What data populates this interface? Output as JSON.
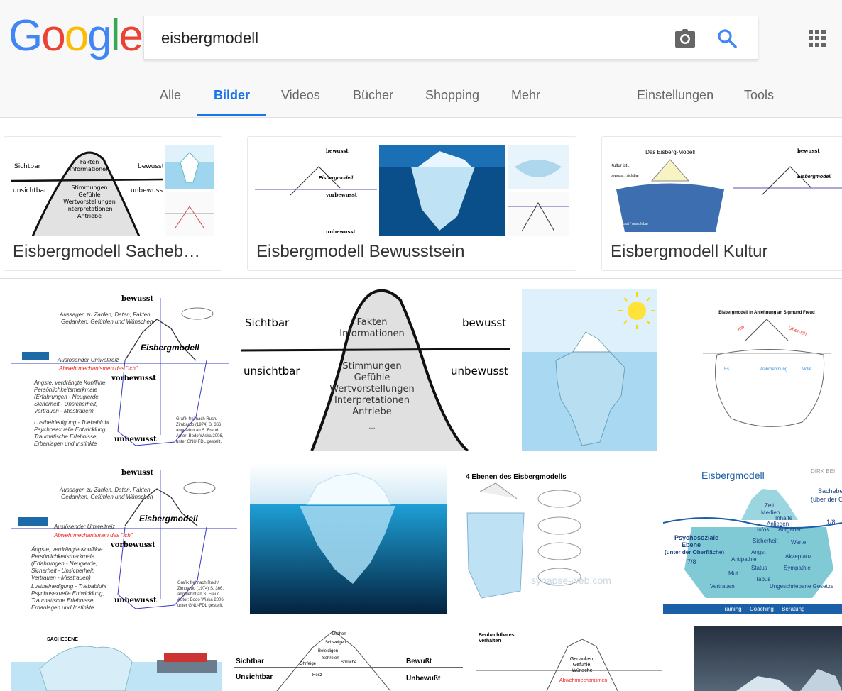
{
  "logo": {
    "letters": [
      "G",
      "o",
      "o",
      "g",
      "l",
      "e"
    ],
    "colors": [
      "#4285F4",
      "#EA4335",
      "#FBBC05",
      "#4285F4",
      "#34A853",
      "#EA4335"
    ]
  },
  "search": {
    "query": "eisbergmodell"
  },
  "tabs": {
    "alle": "Alle",
    "bilder": "Bilder",
    "videos": "Videos",
    "buecher": "Bücher",
    "shopping": "Shopping",
    "mehr": "Mehr",
    "einstellungen": "Einstellungen",
    "tools": "Tools"
  },
  "related": [
    {
      "title": "Eisbergmodell Sacheb…"
    },
    {
      "title": "Eisbergmodell Bewusstsein"
    },
    {
      "title": "Eisbergmodell Kultur"
    }
  ],
  "img_text": {
    "sichtbar": "Sichtbar",
    "unsichtbar": "unsichtbar",
    "bewusst_cut": "bewusst",
    "unbewusst_cut": "unbewusst",
    "fakten": "Fakten",
    "informationen": "Informationen",
    "stimmungen": "Stimmungen",
    "gefuehle": "Gefühle",
    "wertvorstellungen": "Wertvorstellungen",
    "interpretationen": "Interpretationen",
    "antriebe": "Antriebe",
    "dots": "...",
    "bewusst": "bewusst",
    "vorbewusst": "vorbewusst",
    "unbewusst": "unbewusst",
    "eisbergmodell_label": "Eisbergmodell",
    "aussagen": "Aussagen zu Zahlen, Daten, Fakten,",
    "gedanken": "Gedanken, Gefühlen und Wünschen",
    "ausloesender": "Auslösender Umweltreiz",
    "abwehr": "Abwehrmechanismen des \"Ich\"",
    "aengste1": "Ängste, verdrängte Konflikte",
    "aengste2": "Persönlichkeitsmerkmale",
    "aengste3": "(Erfahrungen - Neugierde,",
    "aengste4": "Sicherheit - Unsicherheit,",
    "aengste5": "Vertrauen - Misstrauen)",
    "lust1": "Lustbefriedigung - Triebabfuhr",
    "lust2": "Psychosexuelle Entwicklung,",
    "lust3": "Traumatische Erlebnisse,",
    "lust4": "Erbanlagen und Instinkte",
    "grafik1": "Grafik frei nach Ruch/",
    "grafik2": "Zimbardo (1974) S. 366,",
    "grafik3": "angelehnt an S. Freud.",
    "grafik4": "Autor: Bodo Wiska 2006,",
    "grafik5": "unter GNU-FDL gestellt.",
    "freud_title": "Eisbergmodell in Anlehnung an Sigmund Freud",
    "vier_ebenen": "4 Ebenen des Eisbergmodells",
    "synapse": "synapse-web.com",
    "eisb2_title": "Eisbergmodell",
    "dirk": "DIRK BEI",
    "sachebene": "Sachebene",
    "ueber": "(über der Oberfl",
    "eins_acht": "1/8",
    "psycho1": "Psychosoziale",
    "psycho2": "Ebene",
    "unter": "(unter der Oberfläche)",
    "sieben_acht": "7/8",
    "zeit": "Zeit",
    "medien": "Medien",
    "inhalte": "Inhalte",
    "anliegen": "Anliegen",
    "infos": "Infos",
    "aufgaben": "Aufgaben",
    "sicherheit": "Sicherheit",
    "werte": "Werte",
    "angst": "Angst",
    "akzeptanz": "Akzeptanz",
    "antipathie": "Antipathie",
    "status": "Status",
    "sympathie": "Sympathie",
    "mut": "Mut",
    "tabus": "Tabus",
    "vertrauen": "Vertrauen",
    "ungeschriebene": "Ungeschriebene Gesetze",
    "training": "Training",
    "coaching": "Coaching",
    "beratung": "Beratung",
    "sachebene_caps": "SACHEBENE",
    "sichtbar2": "Sichtbar",
    "unsichtbar2": "Unsichtbar",
    "bewusst_caps": "Bewußt",
    "unbewusst_caps": "Unbewußt",
    "drohen": "Drohen",
    "schweigen": "Schweigen",
    "beleidigen": "Beleidigen",
    "schreien": "Schreien",
    "sprueche": "Sprüche",
    "ohrfeige": "Ohrfeige",
    "hetze": "Heitz",
    "beobachtbares1": "Beobachtbares",
    "beobachtbares2": "Verhalten",
    "gedanken2": "Gedanken,",
    "gefuehle2": "Gefühle,",
    "wuensche": "Wünsche",
    "abwehrm": "Abwehrmechanismen",
    "das_ist": "Das Eisberg-Modell",
    "kultur_ist": "Kultur ist...",
    "bewusst_sichtbar": "bewusst / sichtbar",
    "unbewusst_unsichtbar": "unbewusst / unsichtbar"
  }
}
